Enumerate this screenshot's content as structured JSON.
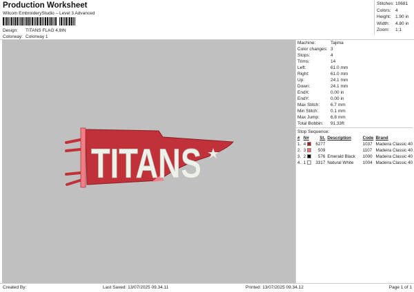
{
  "header": {
    "title": "Production Worksheet",
    "subtitle": "Wilcom EmbroideryStudio – Level 3 Advanced",
    "design_label": "Design:",
    "design_value": "TITANS FLAG 4,8IN",
    "colorway_label": "Colorway:",
    "colorway_value": "Colorway 1"
  },
  "summary": [
    {
      "label": "Stitches:",
      "value": "10681"
    },
    {
      "label": "Colors:",
      "value": "4"
    },
    {
      "label": "Height:",
      "value": "1.90 in"
    },
    {
      "label": "Width:",
      "value": "4.80 in"
    },
    {
      "label": "Zoom:",
      "value": "1:1"
    }
  ],
  "design_preview": {
    "text": "TITANS",
    "colors": {
      "primary": "#c0313a",
      "secondary": "#ef7f86",
      "fill": "#eef0ea"
    }
  },
  "properties": [
    {
      "label": "Machine:",
      "value": "Tajima"
    },
    {
      "label": "Color changes:",
      "value": "3"
    },
    {
      "label": "Stops:",
      "value": "4"
    },
    {
      "label": "Trims:",
      "value": "14"
    },
    {
      "label": "Left:",
      "value": "61.0 mm"
    },
    {
      "label": "Right:",
      "value": "61.0 mm"
    },
    {
      "label": "Up:",
      "value": "24.1 mm"
    },
    {
      "label": "Down:",
      "value": "24.1 mm"
    },
    {
      "label": "EndX:",
      "value": "0.00 in"
    },
    {
      "label": "EndY:",
      "value": "0.00 in"
    },
    {
      "label": "Max Stitch:",
      "value": "6.7 mm"
    },
    {
      "label": "Min Stitch:",
      "value": "0.1 mm"
    },
    {
      "label": "Max Jump:",
      "value": "6.8 mm"
    },
    {
      "label": "Total Bobbin:",
      "value": "91.33ft"
    }
  ],
  "stop_sequence": {
    "title": "Stop Sequence:",
    "columns": [
      "#",
      "N#",
      "St.",
      "Description",
      "Code",
      "Brand"
    ],
    "rows": [
      {
        "num": "1.",
        "n": "4",
        "color": "#b01c26",
        "st": "6277",
        "desc": "",
        "code": "1037",
        "brand": "Madeira Classic 40"
      },
      {
        "num": "2.",
        "n": "3",
        "color": "#ef6a76",
        "st": "509",
        "desc": "",
        "code": "1107",
        "brand": "Madeira Classic 40"
      },
      {
        "num": "3.",
        "n": "2",
        "color": "#000000",
        "st": "576",
        "desc": "Emerald Black",
        "code": "1000",
        "brand": "Madeira Classic 40"
      },
      {
        "num": "4.",
        "n": "1",
        "color": "#f4f4f4",
        "st": "3317",
        "desc": "Natural White",
        "code": "1004",
        "brand": "Madeira Classic 40"
      }
    ]
  },
  "footer": {
    "created_by": "Created By:",
    "last_saved": "Last Saved: 13/07/2025 09.34.11",
    "printed": "Printed: 13/07/2025 09.34.12",
    "page": "Page 1 of 1"
  }
}
